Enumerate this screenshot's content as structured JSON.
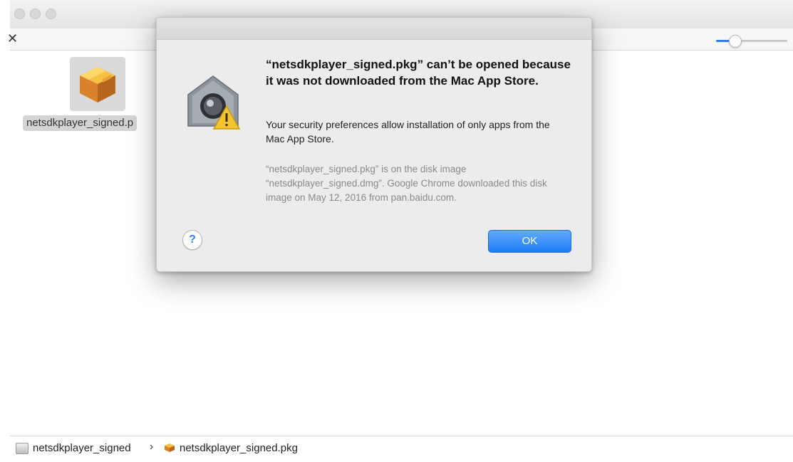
{
  "window": {
    "toolbar": {
      "close_glyph": "✕"
    }
  },
  "finder": {
    "file_label": "netsdkplayer_signed.p",
    "pathbar": {
      "volume": "netsdkplayer_signed",
      "separator": "›",
      "file": "netsdkplayer_signed.pkg"
    }
  },
  "dialog": {
    "title": "“netsdkplayer_signed.pkg” can’t be opened because it was not downloaded from the Mac App Store.",
    "body": "Your security preferences allow installation of only apps from the Mac App Store.",
    "detail": "“netsdkplayer_signed.pkg” is on the disk image “netsdkplayer_signed.dmg”. Google Chrome downloaded this disk image on May 12, 2016 from pan.baidu.com.",
    "help_label": "?",
    "ok_label": "OK"
  },
  "colors": {
    "accent": "#1f7cf4",
    "warning": "#f4c430"
  },
  "icons": [
    "close-icon",
    "package-icon",
    "gatekeeper-icon",
    "warning-icon",
    "disk-icon",
    "help-icon"
  ]
}
